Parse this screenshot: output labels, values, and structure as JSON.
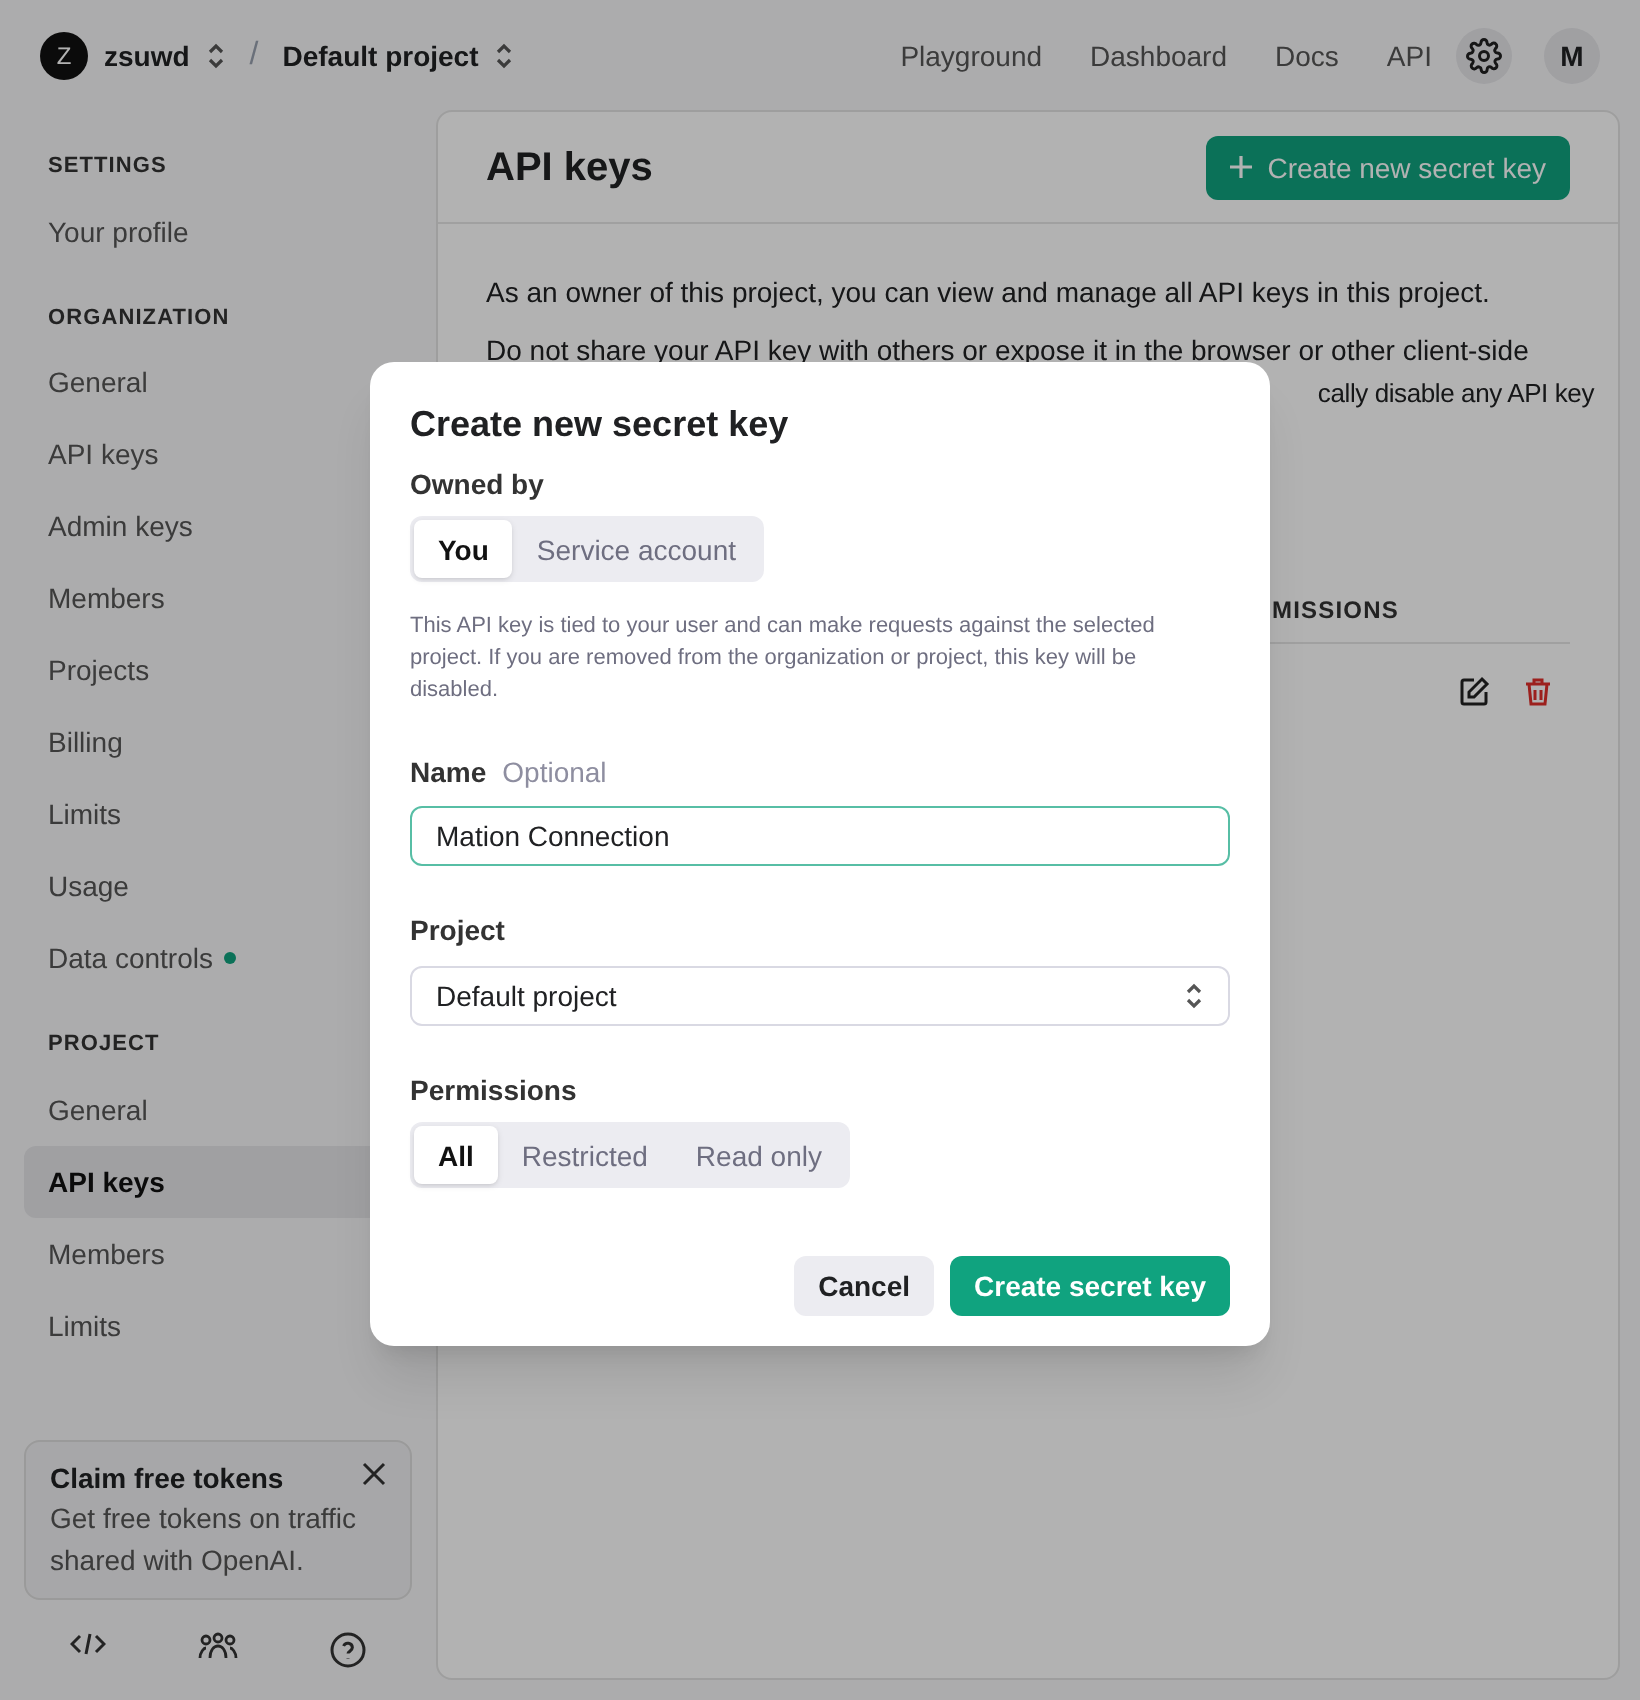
{
  "topbar": {
    "org_avatar": "Z",
    "org": "zsuwd",
    "separator": "/",
    "project": "Default project",
    "nav": [
      "Playground",
      "Dashboard",
      "Docs",
      "API"
    ],
    "user_avatar": "M"
  },
  "sidebar": {
    "sections": [
      {
        "heading": "SETTINGS",
        "items": [
          {
            "label": "Your profile",
            "selected": false,
            "dot": false
          }
        ]
      },
      {
        "heading": "ORGANIZATION",
        "items": [
          {
            "label": "General",
            "selected": false,
            "dot": false
          },
          {
            "label": "API keys",
            "selected": false,
            "dot": false
          },
          {
            "label": "Admin keys",
            "selected": false,
            "dot": false
          },
          {
            "label": "Members",
            "selected": false,
            "dot": false
          },
          {
            "label": "Projects",
            "selected": false,
            "dot": false
          },
          {
            "label": "Billing",
            "selected": false,
            "dot": false
          },
          {
            "label": "Limits",
            "selected": false,
            "dot": false
          },
          {
            "label": "Usage",
            "selected": false,
            "dot": false
          },
          {
            "label": "Data controls",
            "selected": false,
            "dot": true
          }
        ]
      },
      {
        "heading": "PROJECT",
        "items": [
          {
            "label": "General",
            "selected": false,
            "dot": false
          },
          {
            "label": "API keys",
            "selected": true,
            "dot": false
          },
          {
            "label": "Members",
            "selected": false,
            "dot": false
          },
          {
            "label": "Limits",
            "selected": false,
            "dot": false
          }
        ]
      }
    ],
    "promo": {
      "title": "Claim free tokens",
      "text": "Get free tokens on traffic shared with OpenAI."
    }
  },
  "main": {
    "title": "API keys",
    "create_button": "Create new secret key",
    "intro": "As an owner of this project, you can view and manage all API keys in this project.",
    "warning_line_1": "Do not share your API key with others or expose it in the browser or other client-side",
    "warning_line_2_visible": "cally disable any API key",
    "table_header_visible": "MISSIONS"
  },
  "dialog": {
    "title": "Create new secret key",
    "owned_by_label": "Owned by",
    "owned_by_options": [
      {
        "label": "You",
        "selected": true
      },
      {
        "label": "Service account",
        "selected": false
      }
    ],
    "owned_by_help": "This API key is tied to your user and can make requests against the selected project. If you are removed from the organization or project, this key will be disabled.",
    "name_label": "Name",
    "name_hint": "Optional",
    "name_value": "Mation Connection",
    "project_label": "Project",
    "project_value": "Default project",
    "permissions_label": "Permissions",
    "permissions_options": [
      {
        "label": "All",
        "selected": true
      },
      {
        "label": "Restricted",
        "selected": false
      },
      {
        "label": "Read only",
        "selected": false
      }
    ],
    "buttons": {
      "cancel": "Cancel",
      "submit": "Create secret key"
    }
  }
}
